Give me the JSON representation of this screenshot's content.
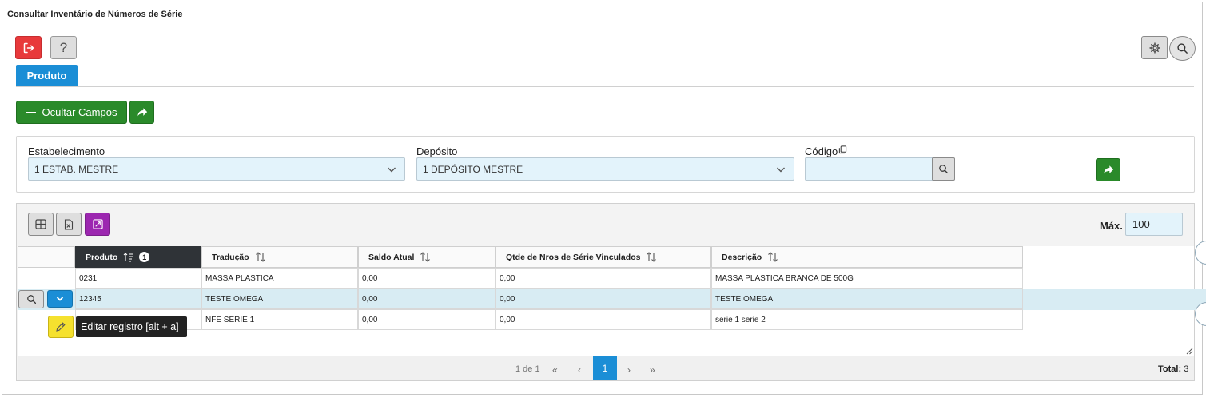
{
  "window": {
    "title": "Consultar Inventário de Números de Série"
  },
  "toolbar": {
    "exit_icon": "exit-icon",
    "help_label": "?",
    "settings_icon": "gear-icon",
    "search_icon": "search-icon"
  },
  "tabs": [
    {
      "label": "Produto",
      "active": true
    }
  ],
  "actions": {
    "hide_fields_label": "Ocultar Campos",
    "share_icon": "share-arrow-icon"
  },
  "filters": {
    "estabelecimento": {
      "label": "Estabelecimento",
      "value": "1 ESTAB. MESTRE"
    },
    "deposito": {
      "label": "Depósito",
      "value": "1 DEPÓSITO MESTRE"
    },
    "codigo": {
      "label": "Código",
      "value": ""
    }
  },
  "grid": {
    "max_label": "Máx.",
    "max_value": "100",
    "columns": [
      {
        "label": "Produto",
        "sorted": true,
        "sort_order": "1"
      },
      {
        "label": "Tradução"
      },
      {
        "label": "Saldo Atual"
      },
      {
        "label": "Qtde de Nros de Série Vinculados"
      },
      {
        "label": "Descrição"
      }
    ],
    "rows": [
      {
        "produto": "0231",
        "traducao": "MASSA PLASTICA",
        "saldo": "0,00",
        "qtde": "0,00",
        "descricao": "MASSA PLASTICA BRANCA DE 500G"
      },
      {
        "produto": "12345",
        "traducao": "TESTE OMEGA",
        "saldo": "0,00",
        "qtde": "0,00",
        "descricao": "TESTE OMEGA"
      },
      {
        "produto": "",
        "traducao": "NFE SERIE 1",
        "saldo": "0,00",
        "qtde": "0,00",
        "descricao": "serie 1 serie 2"
      }
    ],
    "tooltip": "Editar registro [alt + a]",
    "pagination": {
      "info": "1 de 1",
      "first": "«",
      "prev": "‹",
      "current": "1",
      "next": "›",
      "last": "»"
    },
    "total_label": "Total:",
    "total_value": "3"
  },
  "colors": {
    "primary": "#1b8ed6",
    "green": "#2a8a2a",
    "danger": "#e8393b",
    "purple": "#9c27b0",
    "yellow": "#f5e12e",
    "input_bg": "#e3f3fb",
    "dark_header": "#2f3337"
  }
}
